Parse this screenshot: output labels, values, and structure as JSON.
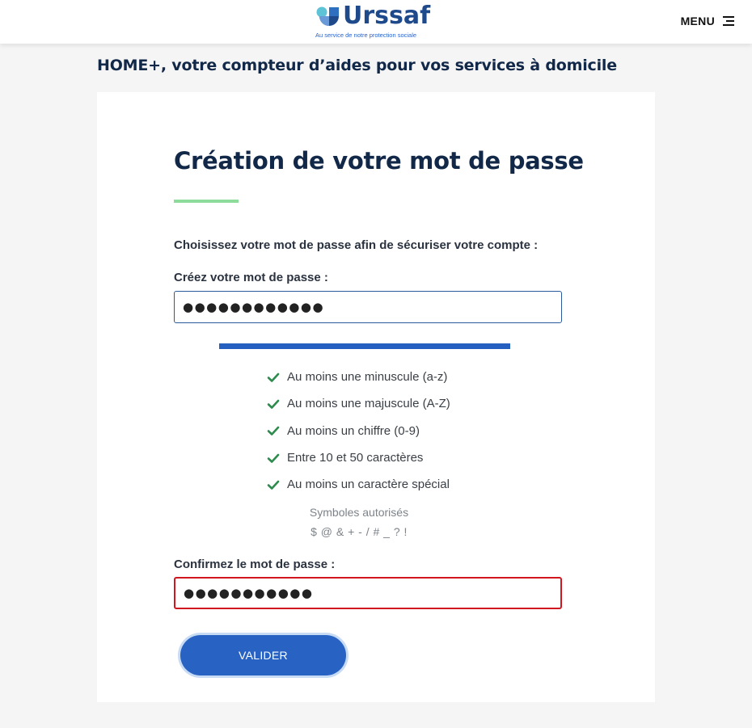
{
  "colors": {
    "brand_blue": "#1e4a8c",
    "primary_button": "#2863c4",
    "accent_rule": "#8ddc9c",
    "check_green": "#2e8b4e",
    "error_red": "#d0161e"
  },
  "header": {
    "logo_word": "Urssaf",
    "logo_tagline": "Au service de notre protection sociale",
    "menu_label": "MENU",
    "menu_icon": "hamburger-icon"
  },
  "page": {
    "heading": "HOME+, votre compteur d’aides pour vos services à domicile"
  },
  "form": {
    "title": "Création de votre mot de passe",
    "intro": "Choisissez votre mot de passe afin de sécuriser votre compte :",
    "create_label": "Créez votre mot de passe :",
    "create_value": "●●●●●●●●●●●●",
    "strength_fraction": 1.0,
    "rules": [
      {
        "text": "Au moins une minuscule (a-z)",
        "met": true,
        "icon": "check-icon"
      },
      {
        "text": "Au moins une majuscule (A-Z)",
        "met": true,
        "icon": "check-icon"
      },
      {
        "text": "Au moins un chiffre (0-9)",
        "met": true,
        "icon": "check-icon"
      },
      {
        "text": "Entre 10 et 50 caractères",
        "met": true,
        "icon": "check-icon"
      },
      {
        "text": "Au moins un caractère spécial",
        "met": true,
        "icon": "check-icon"
      }
    ],
    "symbols_title": "Symboles autorisés",
    "symbols": "$ @ & + - / # _ ? !",
    "confirm_label": "Confirmez le mot de passe :",
    "confirm_value": "●●●●●●●●●●●",
    "submit_label": "VALIDER"
  }
}
